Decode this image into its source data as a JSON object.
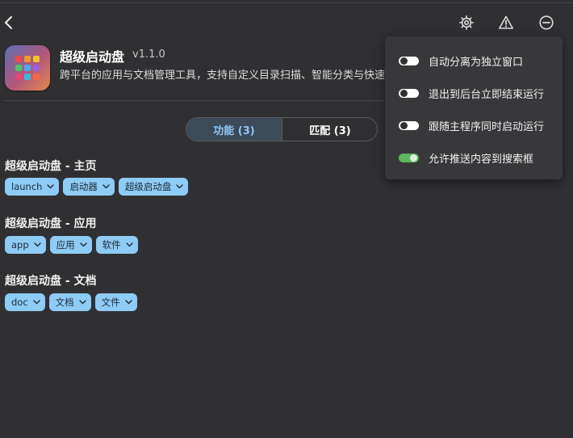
{
  "plugin": {
    "name": "超级启动盘",
    "version": "v1.1.0",
    "description": "跨平台的应用与文档管理工具，支持自定义目录扫描、智能分类与快速"
  },
  "tabs": [
    {
      "label": "功能 (3)",
      "selected": true
    },
    {
      "label": "匹配 (3)",
      "selected": false
    }
  ],
  "features": [
    {
      "title": "超级启动盘 - 主页",
      "keywords": [
        "launch",
        "启动器",
        "超级启动盘"
      ]
    },
    {
      "title": "超级启动盘 - 应用",
      "keywords": [
        "app",
        "应用",
        "软件"
      ]
    },
    {
      "title": "超级启动盘 - 文档",
      "keywords": [
        "doc",
        "文档",
        "文件"
      ]
    }
  ],
  "menu": [
    {
      "label": "自动分离为独立窗口",
      "enabled": false
    },
    {
      "label": "退出到后台立即结束运行",
      "enabled": false
    },
    {
      "label": "跟随主程序同时启动运行",
      "enabled": false
    },
    {
      "label": "允许推送内容到搜索框",
      "enabled": true
    }
  ],
  "icons": {
    "back": "chevron-left-icon",
    "settings": "gear-icon",
    "warning": "warning-icon",
    "remove": "minus-circle-icon"
  },
  "colors": {
    "background": "#303033",
    "chip": "#8ecbf5",
    "tab_selected_text": "#8fc6f5",
    "toggle_on": "#5cb65c"
  },
  "app_icon_colors": [
    "#ef4a4a",
    "#f29a2e",
    "#f4c430",
    "#4cc36a",
    "#49a8f0",
    "#9c5fe0",
    "#e8457a",
    "#3fb8d8",
    "#f06a3c"
  ]
}
